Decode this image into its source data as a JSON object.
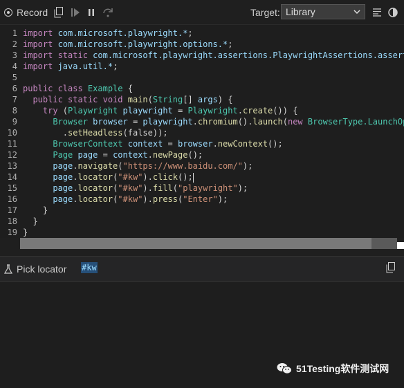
{
  "toolbar": {
    "record_label": "Record",
    "target_label": "Target:",
    "target_value": "Library"
  },
  "editor": {
    "lines": [
      {
        "n": "1",
        "parts": [
          [
            "kw",
            "import "
          ],
          [
            "var",
            "com.microsoft.playwright.*"
          ],
          [
            "plain",
            ";"
          ]
        ]
      },
      {
        "n": "2",
        "parts": [
          [
            "kw",
            "import "
          ],
          [
            "var",
            "com.microsoft.playwright.options.*"
          ],
          [
            "plain",
            ";"
          ]
        ]
      },
      {
        "n": "3",
        "parts": [
          [
            "kw",
            "import static "
          ],
          [
            "var",
            "com.microsoft.playwright.assertions.PlaywrightAssertions.assertT"
          ]
        ]
      },
      {
        "n": "4",
        "parts": [
          [
            "kw",
            "import "
          ],
          [
            "var",
            "java.util.*"
          ],
          [
            "plain",
            ";"
          ]
        ]
      },
      {
        "n": "5",
        "parts": []
      },
      {
        "n": "6",
        "parts": [
          [
            "kw",
            "public class "
          ],
          [
            "cls",
            "Example "
          ],
          [
            "plain",
            "{"
          ]
        ]
      },
      {
        "n": "7",
        "parts": [
          [
            "kw",
            "  public static void "
          ],
          [
            "fn",
            "main"
          ],
          [
            "plain",
            "("
          ],
          [
            "cls",
            "String"
          ],
          [
            "plain",
            "[] "
          ],
          [
            "var",
            "args"
          ],
          [
            "plain",
            ") {"
          ]
        ]
      },
      {
        "n": "8",
        "parts": [
          [
            "kw",
            "    try "
          ],
          [
            "plain",
            "("
          ],
          [
            "cls",
            "Playwright "
          ],
          [
            "var",
            "playwright"
          ],
          [
            "plain",
            " = "
          ],
          [
            "cls",
            "Playwright"
          ],
          [
            "plain",
            "."
          ],
          [
            "fn",
            "create"
          ],
          [
            "plain",
            "()) {"
          ]
        ]
      },
      {
        "n": "9",
        "parts": [
          [
            "cls",
            "      Browser "
          ],
          [
            "var",
            "browser"
          ],
          [
            "plain",
            " = "
          ],
          [
            "var",
            "playwright"
          ],
          [
            "plain",
            "."
          ],
          [
            "fn",
            "chromium"
          ],
          [
            "plain",
            "()."
          ],
          [
            "fn",
            "launch"
          ],
          [
            "plain",
            "("
          ],
          [
            "kw",
            "new "
          ],
          [
            "cls",
            "BrowserType.LaunchOpt"
          ]
        ]
      },
      {
        "n": "10",
        "parts": [
          [
            "plain",
            "        ."
          ],
          [
            "fn",
            "setHeadless"
          ],
          [
            "plain",
            "(false));"
          ]
        ]
      },
      {
        "n": "11",
        "parts": [
          [
            "cls",
            "      BrowserContext "
          ],
          [
            "var",
            "context"
          ],
          [
            "plain",
            " = "
          ],
          [
            "var",
            "browser"
          ],
          [
            "plain",
            "."
          ],
          [
            "fn",
            "newContext"
          ],
          [
            "plain",
            "();"
          ]
        ]
      },
      {
        "n": "12",
        "parts": [
          [
            "cls",
            "      Page "
          ],
          [
            "var",
            "page"
          ],
          [
            "plain",
            " = "
          ],
          [
            "var",
            "context"
          ],
          [
            "plain",
            "."
          ],
          [
            "fn",
            "newPage"
          ],
          [
            "plain",
            "();"
          ]
        ]
      },
      {
        "n": "13",
        "parts": [
          [
            "var",
            "      page"
          ],
          [
            "plain",
            "."
          ],
          [
            "fn",
            "navigate"
          ],
          [
            "plain",
            "("
          ],
          [
            "str",
            "\"https://www.baidu.com/\""
          ],
          [
            "plain",
            ");"
          ]
        ]
      },
      {
        "n": "14",
        "parts": [
          [
            "var",
            "      page"
          ],
          [
            "plain",
            "."
          ],
          [
            "fn",
            "locator"
          ],
          [
            "plain",
            "("
          ],
          [
            "str",
            "\"#kw\""
          ],
          [
            "plain",
            ")."
          ],
          [
            "fn",
            "click"
          ],
          [
            "plain",
            "();"
          ],
          [
            "cursor",
            ""
          ]
        ]
      },
      {
        "n": "15",
        "parts": [
          [
            "var",
            "      page"
          ],
          [
            "plain",
            "."
          ],
          [
            "fn",
            "locator"
          ],
          [
            "plain",
            "("
          ],
          [
            "str",
            "\"#kw\""
          ],
          [
            "plain",
            ")."
          ],
          [
            "fn",
            "fill"
          ],
          [
            "plain",
            "("
          ],
          [
            "str",
            "\"playwright\""
          ],
          [
            "plain",
            ");"
          ]
        ]
      },
      {
        "n": "16",
        "parts": [
          [
            "var",
            "      page"
          ],
          [
            "plain",
            "."
          ],
          [
            "fn",
            "locator"
          ],
          [
            "plain",
            "("
          ],
          [
            "str",
            "\"#kw\""
          ],
          [
            "plain",
            ")."
          ],
          [
            "fn",
            "press"
          ],
          [
            "plain",
            "("
          ],
          [
            "str",
            "\"Enter\""
          ],
          [
            "plain",
            ");"
          ]
        ]
      },
      {
        "n": "17",
        "parts": [
          [
            "plain",
            "    }"
          ]
        ]
      },
      {
        "n": "18",
        "parts": [
          [
            "plain",
            "  }"
          ]
        ]
      },
      {
        "n": "19",
        "parts": [
          [
            "plain",
            "}"
          ]
        ]
      }
    ]
  },
  "locator": {
    "pick_label": "Pick locator",
    "value": "#kw"
  },
  "watermark": {
    "text": "51Testing软件测试网"
  }
}
